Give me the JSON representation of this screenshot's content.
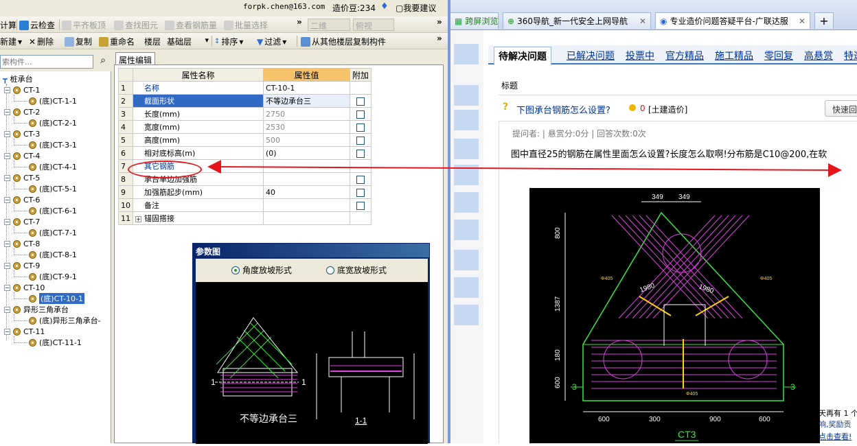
{
  "toolbar1": {
    "calc": "计算",
    "cloud_check": "云检查",
    "align_top": "平齐板顶",
    "find_elem": "查找图元",
    "view_rebar": "查看钢筋量",
    "batch_select": "批量选择",
    "view_2d": "二维",
    "view_mode": "俯视"
  },
  "toolbar2": {
    "new": "新建",
    "delete": "删除",
    "copy": "复制",
    "rename": "重命名",
    "floor_label": "楼层",
    "floor_value": "基础层",
    "sort": "排序",
    "filter": "过滤",
    "copy_from_floor": "从其他楼层复制构件"
  },
  "user": {
    "email": "forpk.chen@163.com",
    "price_beans": "造价豆:234",
    "suggest": "我要建议"
  },
  "search": {
    "placeholder": "索构件..."
  },
  "tree": {
    "root": "桩承台",
    "groups": [
      {
        "name": "CT-1",
        "child": "(底)CT-1-1"
      },
      {
        "name": "CT-2",
        "child": "(底)CT-2-1"
      },
      {
        "name": "CT-3",
        "child": "(底)CT-3-1"
      },
      {
        "name": "CT-4",
        "child": "(底)CT-4-1"
      },
      {
        "name": "CT-5",
        "child": "(底)CT-5-1"
      },
      {
        "name": "CT-6",
        "child": "(底)CT-6-1"
      },
      {
        "name": "CT-7",
        "child": "(底)CT-7-1"
      },
      {
        "name": "CT-8",
        "child": "(底)CT-8-1"
      },
      {
        "name": "CT-9",
        "child": "(底)CT-9-1"
      },
      {
        "name": "CT-10",
        "child": "(底)CT-10-1"
      },
      {
        "name": "异形三角承台",
        "child": "(底)异形三角承台-"
      },
      {
        "name": "CT-11",
        "child": "(底)CT-11-1"
      }
    ]
  },
  "props": {
    "tab": "属性编辑",
    "headers": {
      "name": "属性名称",
      "value": "属性值",
      "extra": "附加"
    },
    "rows": [
      {
        "n": "1",
        "name": "名称",
        "value": "CT-10-1",
        "check": false
      },
      {
        "n": "2",
        "name": "截面形状",
        "value": "不等边承台三",
        "check": true
      },
      {
        "n": "3",
        "name": "长度(mm)",
        "value": "2750",
        "check": true
      },
      {
        "n": "4",
        "name": "宽度(mm)",
        "value": "2530",
        "check": true
      },
      {
        "n": "5",
        "name": "高度(mm)",
        "value": "500",
        "check": true
      },
      {
        "n": "6",
        "name": "相对底标高(m)",
        "value": "(0)",
        "check": true
      },
      {
        "n": "7",
        "name": "其它钢筋",
        "value": "",
        "check": false
      },
      {
        "n": "8",
        "name": "承台单边加强筋",
        "value": "",
        "check": true
      },
      {
        "n": "9",
        "name": "加强筋起步(mm)",
        "value": "40",
        "check": true
      },
      {
        "n": "10",
        "name": "备注",
        "value": "",
        "check": true
      },
      {
        "n": "11",
        "name": "锚固搭接",
        "value": "",
        "check": false
      }
    ]
  },
  "dialog": {
    "title": "参数图",
    "opt1": "角度放坡形式",
    "opt2": "底宽放坡形式",
    "caption": "不等边承台三",
    "section_label": "1-1",
    "mark1": "1"
  },
  "browser": {
    "tabs": [
      "跨屏浏览",
      "360导航_新一代安全上网导航",
      "专业造价问题答疑平台-广联达服"
    ],
    "new_tab": "+"
  },
  "qa": {
    "tabs": [
      "待解决问题",
      "已解决问题",
      "投票中",
      "官方精品",
      "施工精品",
      "零回复",
      "高悬赏",
      "特邀"
    ],
    "label_title": "标题",
    "question": "下图承台钢筋怎么设置?",
    "reward": "0",
    "category": "[土建造价]",
    "answer_btn": "快速回",
    "meta": "提问者:  | 悬赏分:0分  | 回答次数:0次",
    "body": "图中直径25的钢筋在属性里面怎么设置?长度怎么取啊!分布筋是C10@200,在软",
    "side_text": [
      "天再有 1 个",
      "响,奖励贡",
      "点击查看!"
    ]
  },
  "cad": {
    "title": "CT3",
    "dims_top": [
      "349",
      "349"
    ],
    "dims_bottom": [
      "600",
      "300",
      "900",
      "600"
    ],
    "dims_left": [
      "800",
      "1387",
      "180",
      "600"
    ],
    "dims_mid": [
      "1980",
      "1980"
    ],
    "marks": [
      "3",
      "3"
    ],
    "bar_labels": [
      "Φ405",
      "Φ405",
      "Φ405"
    ]
  }
}
